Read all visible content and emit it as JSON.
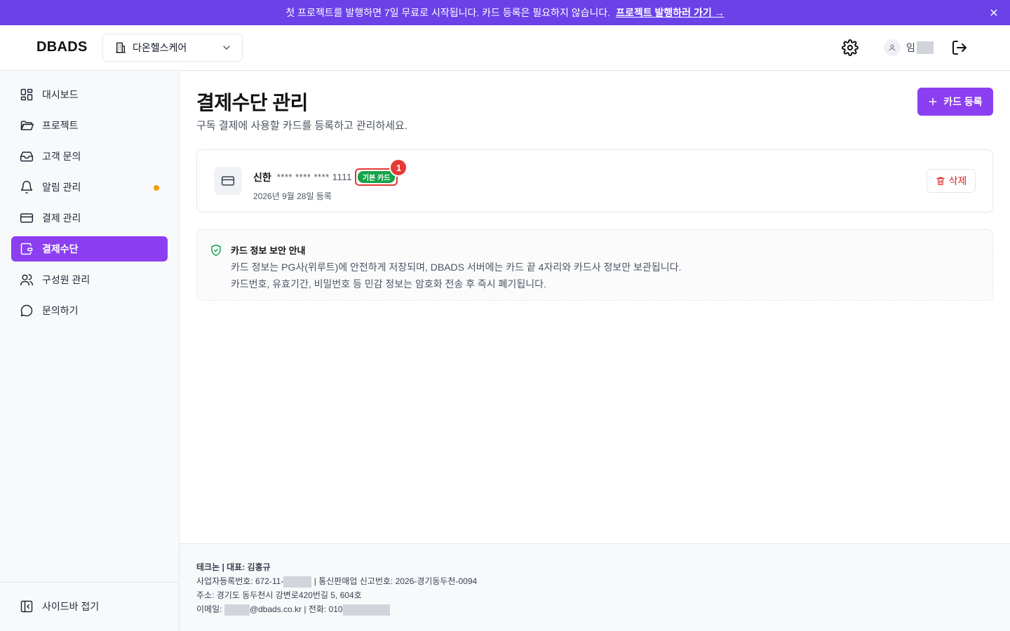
{
  "banner": {
    "text": "첫 프로젝트를 발행하면 7일 무료로 시작됩니다. 카드 등록은 필요하지 않습니다.",
    "link": "프로젝트 발행하러 가기 →"
  },
  "header": {
    "logo": "DBADS",
    "org": "다온헬스케어",
    "user_name": "임"
  },
  "sidebar": {
    "items": [
      {
        "label": "대시보드",
        "icon": "dashboard-icon"
      },
      {
        "label": "프로젝트",
        "icon": "folder-icon"
      },
      {
        "label": "고객 문의",
        "icon": "inbox-icon"
      },
      {
        "label": "알림 관리",
        "icon": "bell-icon"
      },
      {
        "label": "결제 관리",
        "icon": "credit-card-icon"
      },
      {
        "label": "결제수단",
        "icon": "wallet-icon",
        "active": true
      },
      {
        "label": "구성원 관리",
        "icon": "users-icon"
      },
      {
        "label": "문의하기",
        "icon": "chat-icon"
      }
    ],
    "collapse_label": "사이드바 접기"
  },
  "main": {
    "title": "결제수단 관리",
    "subtitle": "구독 결제에 사용할 카드를 등록하고 관리하세요.",
    "add_button": "카드 등록",
    "card": {
      "bank": "신한",
      "number": "**** **** **** 1111",
      "badge": "기본 카드",
      "annotation": "1",
      "date": "2026년 9월 28일 등록",
      "delete": "삭제"
    },
    "notice": {
      "title": "카드 정보 보안 안내",
      "line1": "카드 정보는 PG사(위루트)에 안전하게 저장되며, DBADS 서버에는 카드 끝 4자리와 카드사 정보만 보관됩니다.",
      "line2": "카드번호, 유효기간, 비밀번호 등 민감 정보는 암호화 전송 후 즉시 폐기됩니다."
    }
  },
  "footer": {
    "company": "테크논 | 대표: 김홍규",
    "biz_prefix": "사업자등록번호: 672-11-",
    "biz_suffix": "| 통신판매업 신고번호: 2026-경기동두천-0094",
    "address": "주소: 경기도 동두천시 강변로420번길 5, 604호",
    "email_prefix": "이메일:",
    "email_domain": "@dbads.co.kr | 전화: 010"
  },
  "colors": {
    "accent": "#8b3ff0",
    "banner": "#6a42e8",
    "badge": "#16a34a",
    "danger": "#dc2626"
  }
}
